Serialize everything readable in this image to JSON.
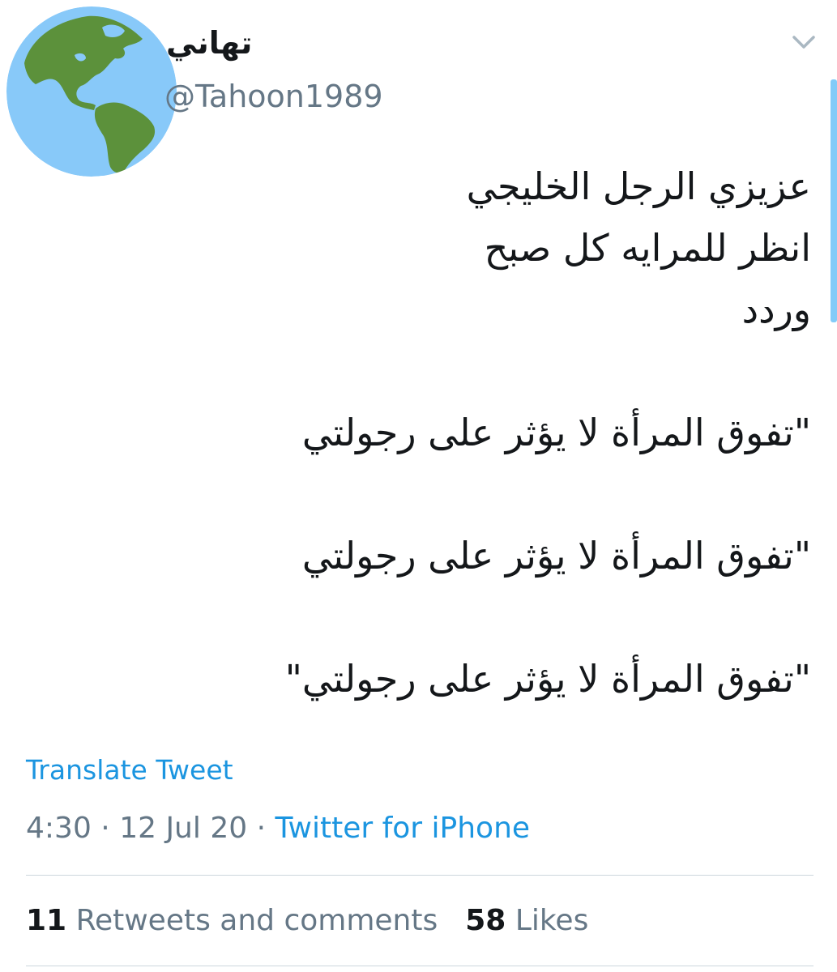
{
  "author": {
    "display_name": "تهاني",
    "handle": "@Tahoon1989",
    "avatar_icon": "globe-americas-icon"
  },
  "menu": {
    "icon": "chevron-down-icon"
  },
  "tweet": {
    "lines": [
      "عزيزي الرجل الخليجي",
      "انظر للمرايه كل صبح",
      "وردد",
      "",
      "\"تفوق المرأة لا يؤثر على رجولتي",
      "",
      "\"تفوق المرأة لا يؤثر على رجولتي",
      "",
      "\"تفوق المرأة لا يؤثر على رجولتي\""
    ],
    "translate_label": "Translate Tweet"
  },
  "meta": {
    "time": "4:30",
    "date": "12 Jul 20",
    "separator": " · ",
    "source": "Twitter for iPhone"
  },
  "stats": {
    "retweets_count": "11",
    "retweets_label": "Retweets and comments",
    "likes_count": "58",
    "likes_label": "Likes"
  },
  "colors": {
    "link": "#1b95e0",
    "secondary_text": "#657786",
    "primary_text": "#14171a",
    "divider": "#ccd6dd",
    "globe_ocean": "#88c9f9",
    "globe_land": "#5c913b"
  }
}
